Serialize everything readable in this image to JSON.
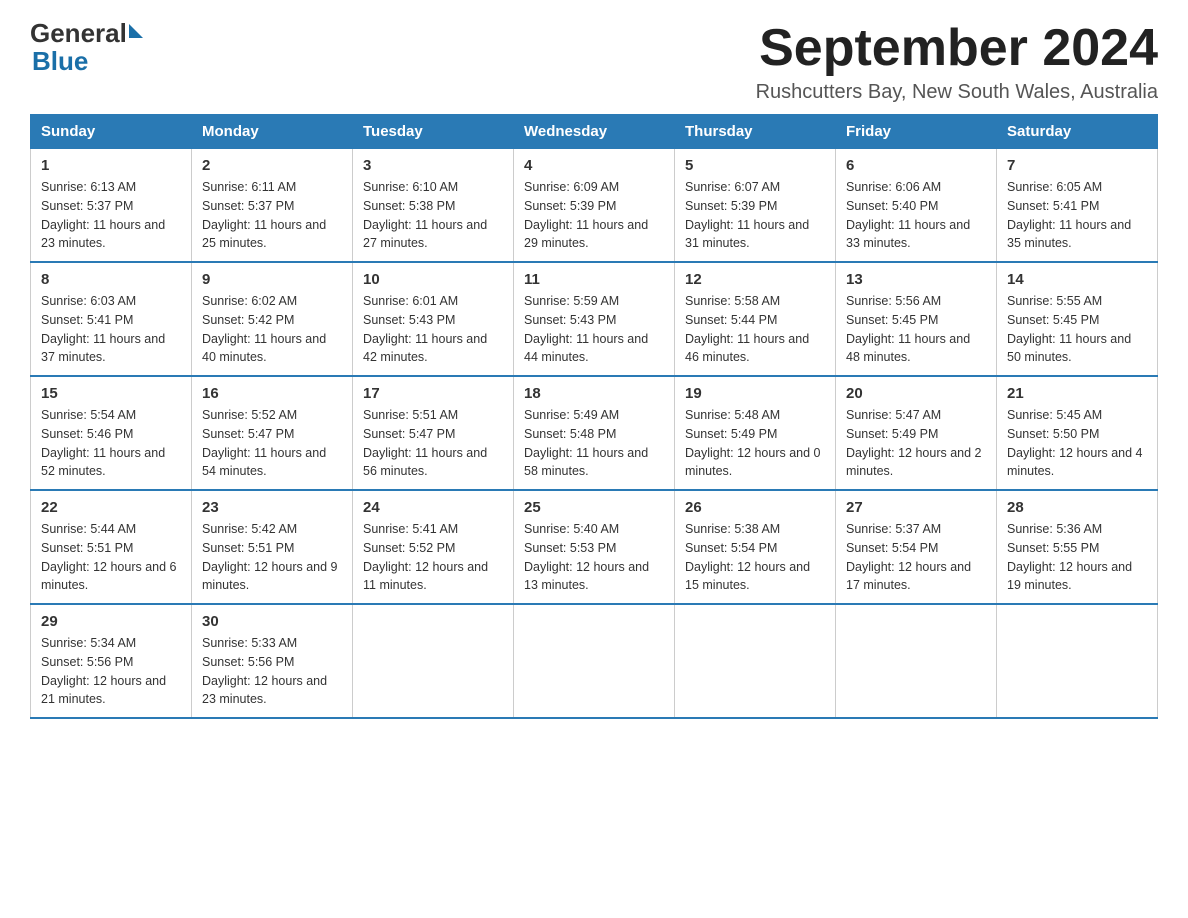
{
  "logo": {
    "general": "General",
    "blue": "Blue"
  },
  "title": "September 2024",
  "subtitle": "Rushcutters Bay, New South Wales, Australia",
  "days_of_week": [
    "Sunday",
    "Monday",
    "Tuesday",
    "Wednesday",
    "Thursday",
    "Friday",
    "Saturday"
  ],
  "weeks": [
    [
      {
        "day": "1",
        "sunrise": "6:13 AM",
        "sunset": "5:37 PM",
        "daylight": "11 hours and 23 minutes."
      },
      {
        "day": "2",
        "sunrise": "6:11 AM",
        "sunset": "5:37 PM",
        "daylight": "11 hours and 25 minutes."
      },
      {
        "day": "3",
        "sunrise": "6:10 AM",
        "sunset": "5:38 PM",
        "daylight": "11 hours and 27 minutes."
      },
      {
        "day": "4",
        "sunrise": "6:09 AM",
        "sunset": "5:39 PM",
        "daylight": "11 hours and 29 minutes."
      },
      {
        "day": "5",
        "sunrise": "6:07 AM",
        "sunset": "5:39 PM",
        "daylight": "11 hours and 31 minutes."
      },
      {
        "day": "6",
        "sunrise": "6:06 AM",
        "sunset": "5:40 PM",
        "daylight": "11 hours and 33 minutes."
      },
      {
        "day": "7",
        "sunrise": "6:05 AM",
        "sunset": "5:41 PM",
        "daylight": "11 hours and 35 minutes."
      }
    ],
    [
      {
        "day": "8",
        "sunrise": "6:03 AM",
        "sunset": "5:41 PM",
        "daylight": "11 hours and 37 minutes."
      },
      {
        "day": "9",
        "sunrise": "6:02 AM",
        "sunset": "5:42 PM",
        "daylight": "11 hours and 40 minutes."
      },
      {
        "day": "10",
        "sunrise": "6:01 AM",
        "sunset": "5:43 PM",
        "daylight": "11 hours and 42 minutes."
      },
      {
        "day": "11",
        "sunrise": "5:59 AM",
        "sunset": "5:43 PM",
        "daylight": "11 hours and 44 minutes."
      },
      {
        "day": "12",
        "sunrise": "5:58 AM",
        "sunset": "5:44 PM",
        "daylight": "11 hours and 46 minutes."
      },
      {
        "day": "13",
        "sunrise": "5:56 AM",
        "sunset": "5:45 PM",
        "daylight": "11 hours and 48 minutes."
      },
      {
        "day": "14",
        "sunrise": "5:55 AM",
        "sunset": "5:45 PM",
        "daylight": "11 hours and 50 minutes."
      }
    ],
    [
      {
        "day": "15",
        "sunrise": "5:54 AM",
        "sunset": "5:46 PM",
        "daylight": "11 hours and 52 minutes."
      },
      {
        "day": "16",
        "sunrise": "5:52 AM",
        "sunset": "5:47 PM",
        "daylight": "11 hours and 54 minutes."
      },
      {
        "day": "17",
        "sunrise": "5:51 AM",
        "sunset": "5:47 PM",
        "daylight": "11 hours and 56 minutes."
      },
      {
        "day": "18",
        "sunrise": "5:49 AM",
        "sunset": "5:48 PM",
        "daylight": "11 hours and 58 minutes."
      },
      {
        "day": "19",
        "sunrise": "5:48 AM",
        "sunset": "5:49 PM",
        "daylight": "12 hours and 0 minutes."
      },
      {
        "day": "20",
        "sunrise": "5:47 AM",
        "sunset": "5:49 PM",
        "daylight": "12 hours and 2 minutes."
      },
      {
        "day": "21",
        "sunrise": "5:45 AM",
        "sunset": "5:50 PM",
        "daylight": "12 hours and 4 minutes."
      }
    ],
    [
      {
        "day": "22",
        "sunrise": "5:44 AM",
        "sunset": "5:51 PM",
        "daylight": "12 hours and 6 minutes."
      },
      {
        "day": "23",
        "sunrise": "5:42 AM",
        "sunset": "5:51 PM",
        "daylight": "12 hours and 9 minutes."
      },
      {
        "day": "24",
        "sunrise": "5:41 AM",
        "sunset": "5:52 PM",
        "daylight": "12 hours and 11 minutes."
      },
      {
        "day": "25",
        "sunrise": "5:40 AM",
        "sunset": "5:53 PM",
        "daylight": "12 hours and 13 minutes."
      },
      {
        "day": "26",
        "sunrise": "5:38 AM",
        "sunset": "5:54 PM",
        "daylight": "12 hours and 15 minutes."
      },
      {
        "day": "27",
        "sunrise": "5:37 AM",
        "sunset": "5:54 PM",
        "daylight": "12 hours and 17 minutes."
      },
      {
        "day": "28",
        "sunrise": "5:36 AM",
        "sunset": "5:55 PM",
        "daylight": "12 hours and 19 minutes."
      }
    ],
    [
      {
        "day": "29",
        "sunrise": "5:34 AM",
        "sunset": "5:56 PM",
        "daylight": "12 hours and 21 minutes."
      },
      {
        "day": "30",
        "sunrise": "5:33 AM",
        "sunset": "5:56 PM",
        "daylight": "12 hours and 23 minutes."
      },
      null,
      null,
      null,
      null,
      null
    ]
  ]
}
